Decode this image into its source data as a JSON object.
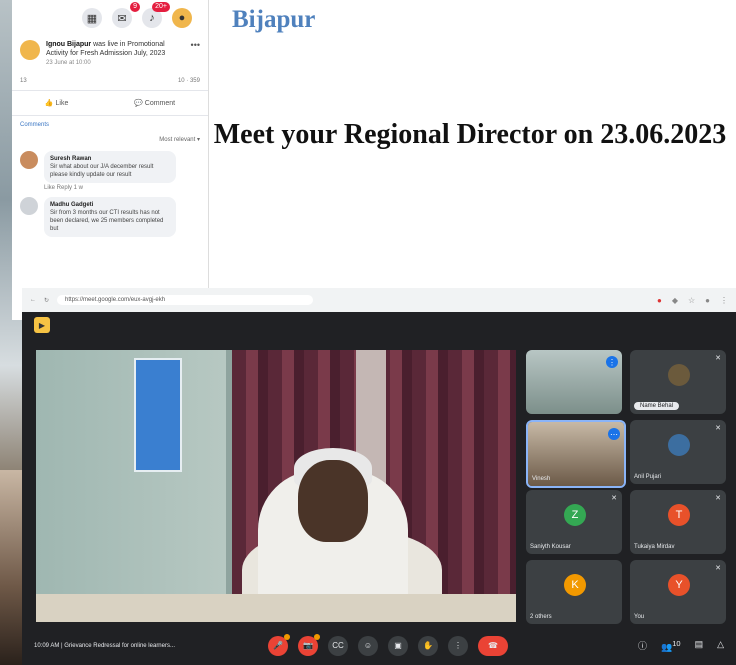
{
  "slide": {
    "place": "Bijapur",
    "headline": "Meet your Regional Director on 23.06.2023"
  },
  "facebook_post": {
    "notification_counts": [
      "9",
      "20+"
    ],
    "author": "Ignou Bijapur",
    "post_text": "was live in Promotional Activity for Fresh Admission July, 2023",
    "time": "23 June at 10:00",
    "reactions_count": "13",
    "comment_share_counts": "10 · 359",
    "like_label": "Like",
    "comment_label": "Comment",
    "comments_label": "Comments",
    "sort_label": "Most relevant",
    "comments": [
      {
        "author": "Suresh Rawan",
        "text": "Sir what about our J/A december result please kindly update our result",
        "actions": "Like   Reply   1 w"
      },
      {
        "author": "Madhu Gadgeti",
        "text": "Sir from 3 months our CTI results has not been declared, we 25 members completed but",
        "actions": ""
      }
    ]
  },
  "browser": {
    "url": "https://meet.google.com/eux-avgj-ekh"
  },
  "meet": {
    "participants": [
      {
        "name": "",
        "avatar_letter": "",
        "avatar_color": "#4a5a6a",
        "kind": "video"
      },
      {
        "name": "Name Behal",
        "avatar_letter": "",
        "avatar_color": "#6b5a3c",
        "kind": "photo"
      },
      {
        "name": "Vinesh",
        "avatar_letter": "",
        "avatar_color": "#5a4a3c",
        "kind": "video-active"
      },
      {
        "name": "Anil Pujari",
        "avatar_letter": "",
        "avatar_color": "#3c6ea0",
        "kind": "photo"
      },
      {
        "name": "Saniyth Kousar",
        "avatar_letter": "Z",
        "avatar_color": "#34a853",
        "kind": "letter"
      },
      {
        "name": "Tukaiya Mirdav",
        "avatar_letter": "T",
        "avatar_color": "#e8512a",
        "kind": "letter"
      },
      {
        "name": "2 others",
        "avatar_letter": "K",
        "avatar_color": "#f29900",
        "kind": "letter"
      },
      {
        "name": "You",
        "avatar_letter": "Y",
        "avatar_color": "#e8512a",
        "kind": "letter"
      }
    ],
    "time": "10:09 AM",
    "meeting_title": "Grievance Redressal for online learners...",
    "participant_count": "10"
  },
  "icons": {
    "mic": "mic-icon",
    "camera": "camera-icon",
    "captions": "captions-icon",
    "emoji": "emoji-icon",
    "present": "present-icon",
    "hand": "raise-hand-icon",
    "more": "more-icon",
    "hangup": "hangup-icon",
    "info": "info-icon",
    "people": "people-icon",
    "chat": "chat-icon",
    "activities": "activities-icon"
  }
}
